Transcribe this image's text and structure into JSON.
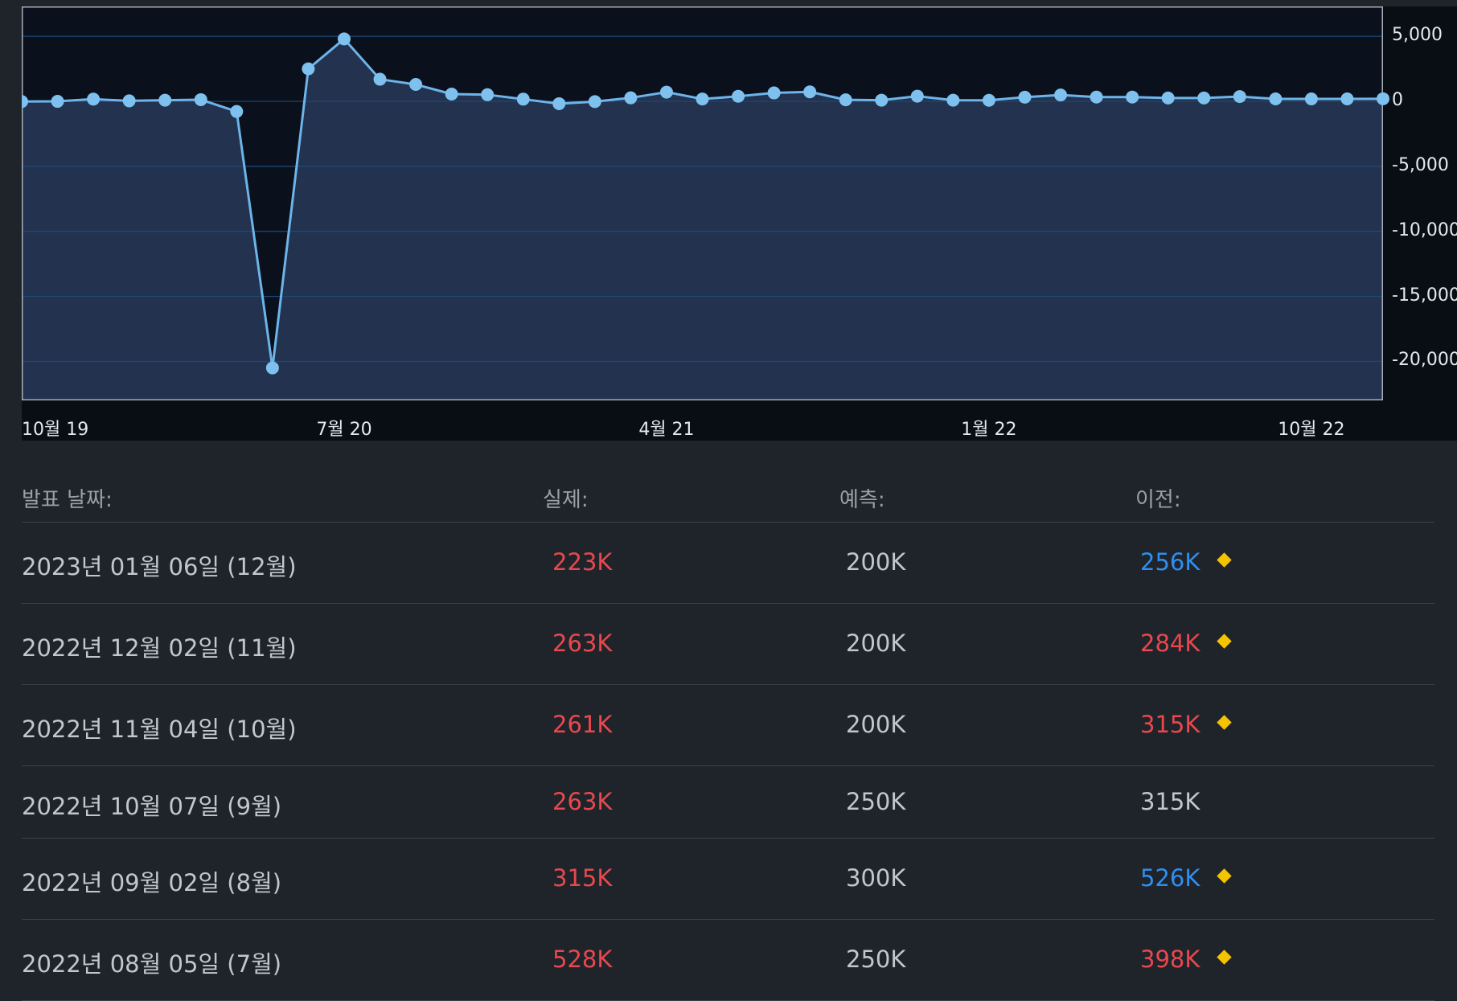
{
  "colors": {
    "red": "#e8484e",
    "blue": "#2f8ef0",
    "neutral": "#c3c7cc",
    "marker": "#f5c400",
    "line": "#6cb4ea",
    "area": "#22324f"
  },
  "chart_data": {
    "type": "area",
    "x_tick_labels": [
      "10월 19",
      "7월 20",
      "4월 21",
      "1월 22",
      "10월 22"
    ],
    "y_tick_labels": [
      "5,000",
      "0",
      "-5,000",
      "-10,000",
      "-15,000",
      "-20,000"
    ],
    "y_ticks": [
      5000,
      0,
      -5000,
      -10000,
      -15000,
      -20000
    ],
    "ylim": [
      -23000,
      7300
    ],
    "grid": true,
    "x": [
      "2019-10",
      "2019-11",
      "2019-12",
      "2020-01",
      "2020-02",
      "2020-03",
      "2020-04",
      "2020-05",
      "2020-06",
      "2020-07",
      "2020-08",
      "2020-09",
      "2020-10",
      "2020-11",
      "2020-12",
      "2021-01",
      "2021-02",
      "2021-03",
      "2021-04",
      "2021-05",
      "2021-06",
      "2021-07",
      "2021-08",
      "2021-09",
      "2021-10",
      "2021-11",
      "2021-12",
      "2022-01",
      "2022-02",
      "2022-03",
      "2022-04",
      "2022-05",
      "2022-06",
      "2022-07",
      "2022-08",
      "2022-09",
      "2022-10",
      "2022-11",
      "2022-12"
    ],
    "values": [
      -16,
      0,
      170,
      40,
      90,
      130,
      -780,
      -20500,
      2500,
      4800,
      1700,
      1300,
      560,
      510,
      170,
      -180,
      -20,
      270,
      710,
      180,
      390,
      650,
      730,
      120,
      90,
      400,
      90,
      80,
      320,
      490,
      330,
      330,
      260,
      260,
      370,
      190,
      190,
      190,
      200
    ]
  },
  "table": {
    "headers": {
      "date": "발표 날짜:",
      "actual": "실제:",
      "forecast": "예측:",
      "previous": "이전:"
    },
    "rows": [
      {
        "date": "2023년 01월 06일 (12월)",
        "actual": "223K",
        "forecast": "200K",
        "previous": "256K",
        "actual_color": "red",
        "previous_color": "blue",
        "revised": true
      },
      {
        "date": "2022년 12월 02일 (11월)",
        "actual": "263K",
        "forecast": "200K",
        "previous": "284K",
        "actual_color": "red",
        "previous_color": "red",
        "revised": true
      },
      {
        "date": "2022년 11월 04일 (10월)",
        "actual": "261K",
        "forecast": "200K",
        "previous": "315K",
        "actual_color": "red",
        "previous_color": "red",
        "revised": true
      },
      {
        "date": "2022년 10월 07일 (9월)",
        "actual": "263K",
        "forecast": "250K",
        "previous": "315K",
        "actual_color": "red",
        "previous_color": "neutral",
        "revised": false
      },
      {
        "date": "2022년 09월 02일 (8월)",
        "actual": "315K",
        "forecast": "300K",
        "previous": "526K",
        "actual_color": "red",
        "previous_color": "blue",
        "revised": true
      },
      {
        "date": "2022년 08월 05일 (7월)",
        "actual": "528K",
        "forecast": "250K",
        "previous": "398K",
        "actual_color": "red",
        "previous_color": "red",
        "revised": true
      }
    ]
  }
}
